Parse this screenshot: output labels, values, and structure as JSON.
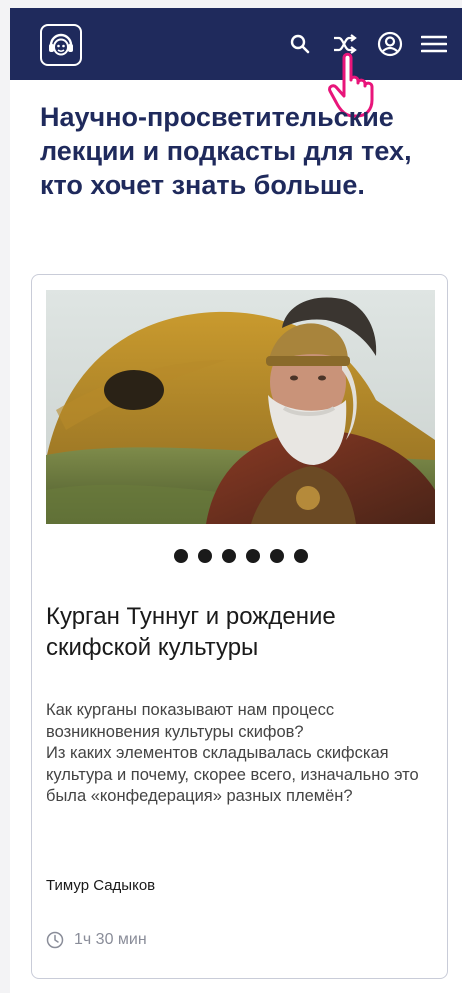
{
  "header": {
    "logo_icon": "monkey-headphones-icon",
    "actions": [
      {
        "name": "search-icon"
      },
      {
        "name": "shuffle-icon"
      },
      {
        "name": "user-icon"
      },
      {
        "name": "menu-icon"
      }
    ]
  },
  "hero": {
    "title": "Научно-просветительские лекции и подкасты для тех, кто хочет знать больше."
  },
  "card": {
    "image_subject": "image-warrior-kurgan",
    "slides_count": 6,
    "title": "Курган Туннуг и рождение скифской культуры",
    "description": [
      "Как курганы показывают нам процесс возникновения культуры скифов?",
      "Из каких элементов складывалась скифская культура и почему, скорее всего, изначально это была «конфедерация» разных племён?"
    ],
    "author": "Тимур Садыков",
    "duration": "1ч 30 мин"
  },
  "colors": {
    "header_bg": "#1f2a5c",
    "title": "#1f2a5c",
    "cursor": "#e8157a"
  }
}
